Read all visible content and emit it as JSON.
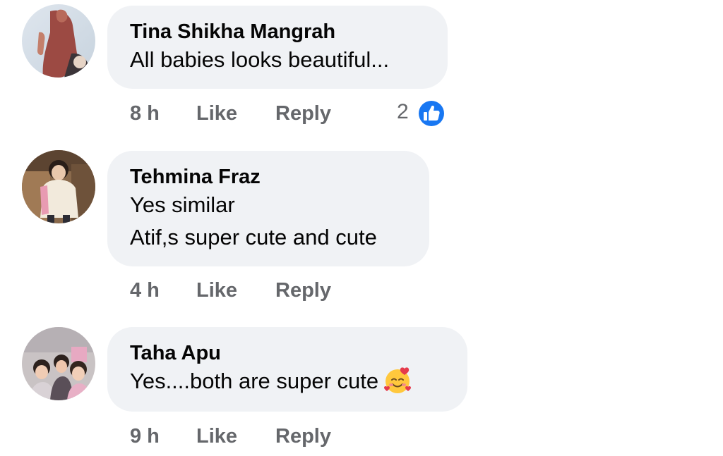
{
  "comments": [
    {
      "author": "Tina Shikha Mangrah",
      "lines": [
        "All babies looks beautiful..."
      ],
      "time": "8 h",
      "like_label": "Like",
      "reply_label": "Reply",
      "reaction_count": "2",
      "reaction_icon": "like-icon"
    },
    {
      "author": "Tehmina Fraz",
      "lines": [
        "Yes similar",
        "Atif,s super cute and cute"
      ],
      "time": "4 h",
      "like_label": "Like",
      "reply_label": "Reply"
    },
    {
      "author": "Taha Apu",
      "lines": [
        "Yes....both are super cute"
      ],
      "emoji": "smiling-face-with-hearts-icon",
      "time": "9 h",
      "like_label": "Like",
      "reply_label": "Reply"
    }
  ],
  "colors": {
    "bubble_bg": "#f0f2f5",
    "text": "#050505",
    "meta": "#65676b",
    "like_blue": "#1877f2"
  }
}
